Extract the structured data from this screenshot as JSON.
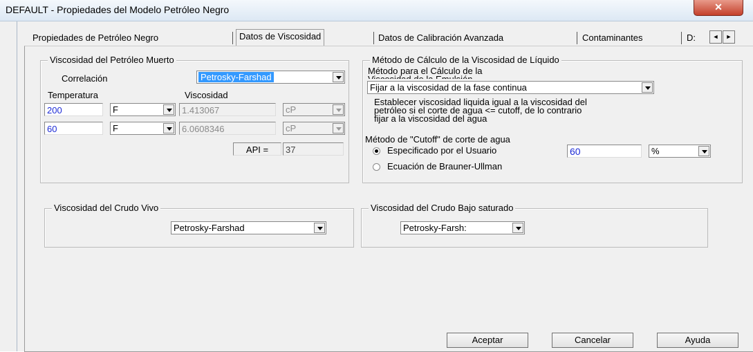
{
  "window": {
    "title": "DEFAULT - Propiedades del Modelo Petróleo Negro",
    "close_glyph": "✕"
  },
  "tabs": [
    {
      "label": "Propiedades de Petróleo Negro"
    },
    {
      "label": "Datos de Viscosidad"
    },
    {
      "label": "Datos de Calibración Avanzada"
    },
    {
      "label": "Contaminantes"
    },
    {
      "label": "D:"
    }
  ],
  "tab_scroll": {
    "left": "◄",
    "right": "►"
  },
  "dead_oil": {
    "title": "Viscosidad del Petróleo Muerto",
    "correlation_label": "Correlación",
    "correlation_value": "Petrosky-Farshad",
    "temperature_header": "Temperatura",
    "viscosity_header": "Viscosidad",
    "rows": [
      {
        "temperature": "200",
        "temp_unit": "F",
        "viscosity": "1.413067",
        "visc_unit": "cP"
      },
      {
        "temperature": "60",
        "temp_unit": "F",
        "viscosity": "6.0608346",
        "visc_unit": "cP"
      }
    ],
    "api_label": "API =",
    "api_value": "37"
  },
  "liquid_viscosity": {
    "title": "Método de Cálculo de la Viscosidad de Líquido",
    "method_label_line1": "Método para el Cálculo de la",
    "method_label_line2": "Viscosidad de la Emulsión",
    "method_value": "Fijar a la viscosidad de la fase continua",
    "description_lines": [
      "Establecer viscosidad liquida igual a la viscosidad del",
      "petróleo si el corte de agua <= cutoff, de lo contrario",
      "fijar a la viscosidad del agua"
    ],
    "cutoff_title": "Método de \"Cutoff\" de corte de agua",
    "option_user": "Especificado por el Usuario",
    "option_user_checked": true,
    "cutoff_value": "60",
    "cutoff_unit": "%",
    "option_brauner": "Ecuación de Brauner-Ullman",
    "option_brauner_checked": false
  },
  "live_oil": {
    "title": "Viscosidad del Crudo Vivo",
    "value": "Petrosky-Farshad"
  },
  "undersaturated": {
    "title": "Viscosidad del Crudo Bajo saturado",
    "value": "Petrosky-Farsh:"
  },
  "buttons": {
    "accept": "Aceptar",
    "cancel": "Cancelar",
    "help": "Ayuda"
  },
  "colors": {
    "input_text_blue": "#1d2bd6",
    "selection": "#3399ff",
    "close_red": "#c4402b"
  }
}
